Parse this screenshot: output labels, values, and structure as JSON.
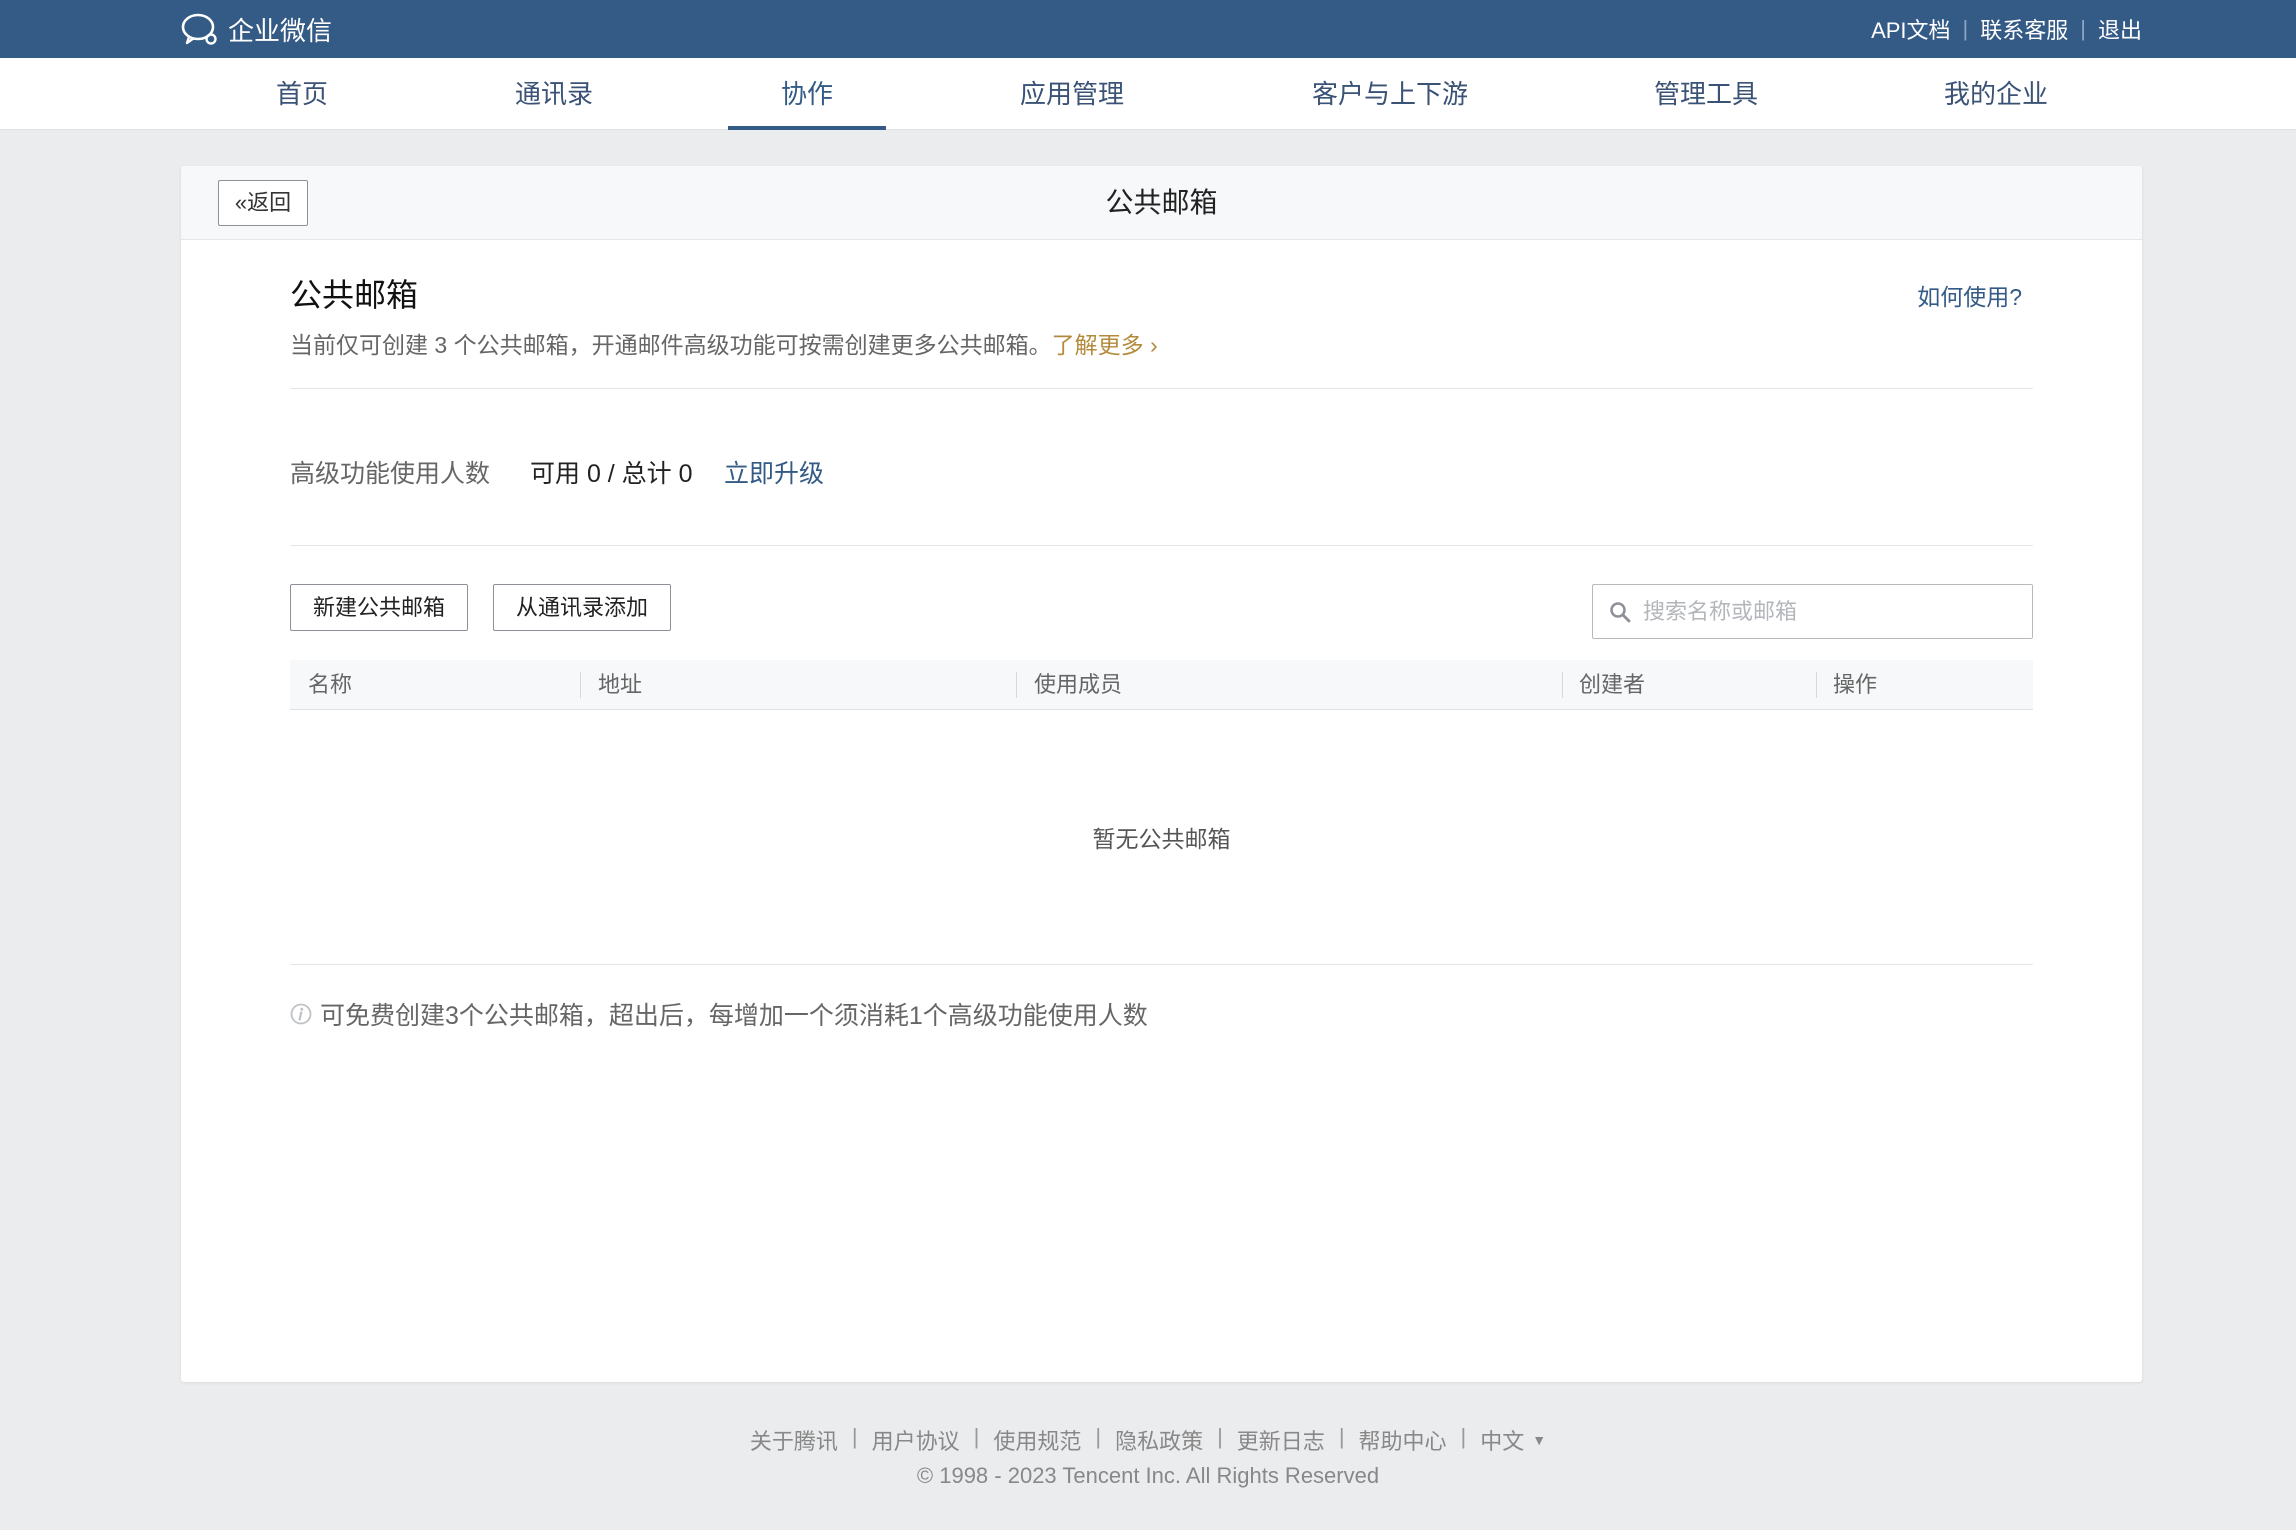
{
  "topbar": {
    "brand": "企业微信",
    "links": [
      "API文档",
      "联系客服",
      "退出"
    ]
  },
  "nav": {
    "items": [
      "首页",
      "通讯录",
      "协作",
      "应用管理",
      "客户与上下游",
      "管理工具",
      "我的企业"
    ],
    "active": "协作"
  },
  "card": {
    "back_label": "返回",
    "header_title": "公共邮箱",
    "section_title": "公共邮箱",
    "help_link": "如何使用?",
    "description": "当前仅可创建 3 个公共邮箱，开通邮件高级功能可按需创建更多公共邮箱。",
    "learn_more": "了解更多",
    "quota_label": "高级功能使用人数",
    "quota_value": "可用 0 / 总计 0",
    "upgrade_link": "立即升级",
    "new_button": "新建公共邮箱",
    "add_from_contacts_button": "从通讯录添加",
    "search_placeholder": "搜索名称或邮箱",
    "table_headers": [
      "名称",
      "地址",
      "使用成员",
      "创建者",
      "操作"
    ],
    "empty_text": "暂无公共邮箱",
    "note": "可免费创建3个公共邮箱，超出后，每增加一个须消耗1个高级功能使用人数"
  },
  "footer": {
    "links": [
      "关于腾讯",
      "用户协议",
      "使用规范",
      "隐私政策",
      "更新日志",
      "帮助中心"
    ],
    "language": "中文",
    "copyright": "© 1998 - 2023 Tencent Inc. All Rights Reserved"
  },
  "colors": {
    "topbar": "#345b86",
    "accent": "#345b86",
    "learn_more": "#b48a3c",
    "background": "#ebecee"
  }
}
